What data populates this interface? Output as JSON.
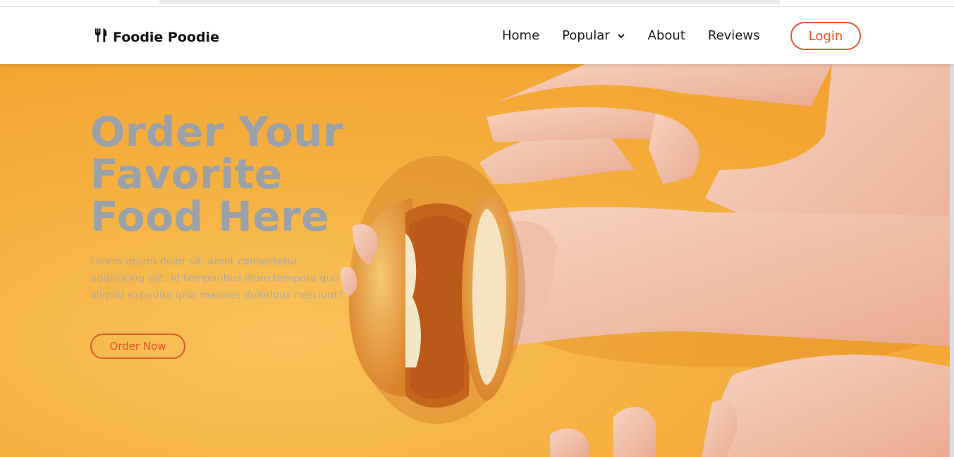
{
  "brand": {
    "name": "Foodie Poodie",
    "icon": "fork-knife-icon"
  },
  "nav": {
    "items": [
      {
        "label": "Home"
      },
      {
        "label": "Popular"
      },
      {
        "label": "About"
      },
      {
        "label": "Reviews"
      }
    ],
    "login_label": "Login"
  },
  "hero": {
    "title": "Order Your Favorite Food Here",
    "text": "Lorem ipsum dolor sit, amet consectetur adipisicing elit. Id temporibus illum tempora quo aliquid expedita ipsa maiores doloribus nesciunt?",
    "cta_label": "Order Now"
  },
  "colors": {
    "accent": "#e4552b",
    "hero_bg": "#f5b040",
    "title": "#9aa1a8"
  }
}
